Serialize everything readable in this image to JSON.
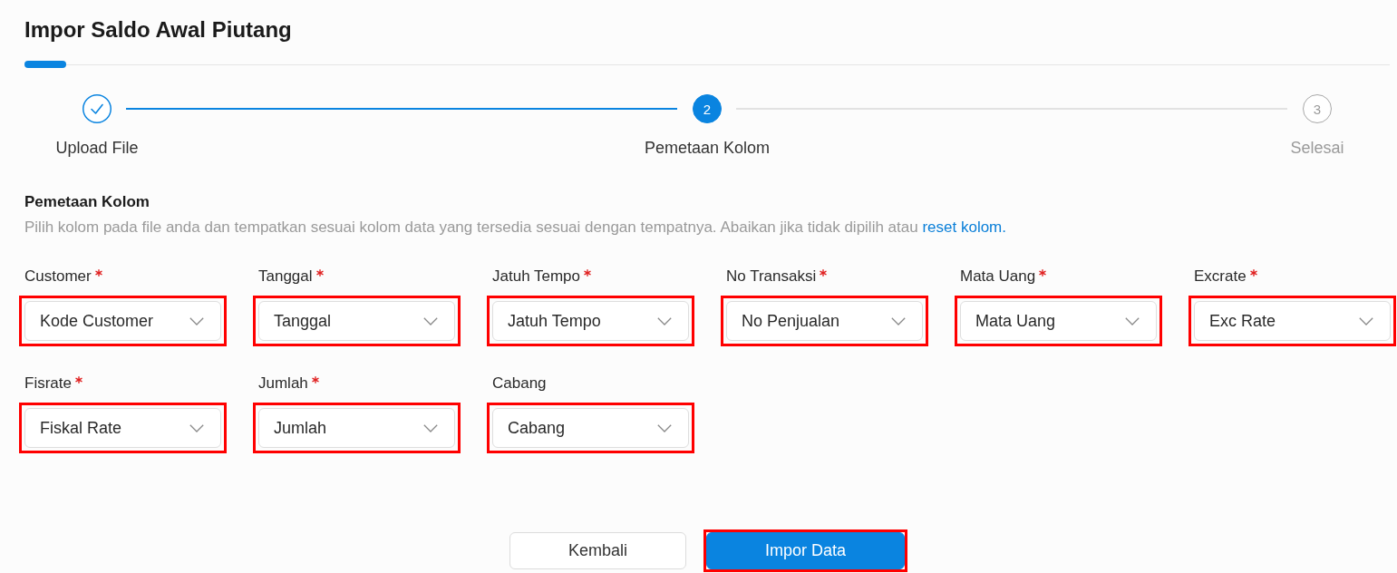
{
  "page": {
    "title": "Impor Saldo Awal Piutang"
  },
  "stepper": {
    "steps": [
      {
        "label": "Upload File",
        "completed": true,
        "selected": false
      },
      {
        "number": "2",
        "label": "Pemetaan Kolom",
        "completed": false,
        "selected": true
      },
      {
        "number": "3",
        "label": "Selesai",
        "completed": false,
        "selected": false
      }
    ]
  },
  "section": {
    "heading": "Pemetaan Kolom",
    "description": "Pilih kolom pada file anda dan tempatkan sesuai kolom data yang tersedia sesuai dengan tempatnya. Abaikan jika tidak dipilih atau",
    "link": "reset kolom."
  },
  "fields": [
    {
      "label": "Customer",
      "required": true,
      "value": "Kode Customer",
      "highlighted": true
    },
    {
      "label": "Tanggal",
      "required": true,
      "value": "Tanggal",
      "highlighted": true
    },
    {
      "label": "Jatuh Tempo",
      "required": true,
      "value": "Jatuh Tempo",
      "highlighted": true
    },
    {
      "label": "No Transaksi",
      "required": true,
      "value": "No Penjualan",
      "highlighted": true
    },
    {
      "label": "Mata Uang",
      "required": true,
      "value": "Mata Uang",
      "highlighted": true
    },
    {
      "label": "Excrate",
      "required": true,
      "value": "Exc Rate",
      "highlighted": true
    },
    {
      "label": "Fisrate",
      "required": true,
      "value": "Fiskal Rate",
      "highlighted": true
    },
    {
      "label": "Jumlah",
      "required": true,
      "value": "Jumlah",
      "highlighted": true
    },
    {
      "label": "Cabang",
      "required": false,
      "value": "Cabang",
      "highlighted": true
    }
  ],
  "buttons": [
    {
      "label": "Kembali",
      "kind": "secondary",
      "highlighted": false
    },
    {
      "label": "Impor Data",
      "kind": "primary",
      "highlighted": true
    }
  ]
}
